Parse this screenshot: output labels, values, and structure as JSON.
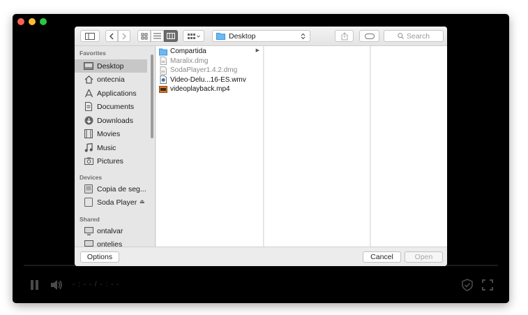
{
  "player": {
    "time_display": "- : - - / - : - -",
    "icons": [
      "close-icon",
      "minimize-icon",
      "zoom-icon",
      "pause-icon",
      "volume-icon",
      "shield-icon",
      "fullscreen-icon"
    ]
  },
  "dialog": {
    "location": "Desktop",
    "search_placeholder": "Search",
    "sidebar": {
      "favorites_header": "Favorites",
      "devices_header": "Devices",
      "shared_header": "Shared",
      "favorites": [
        {
          "label": "Desktop",
          "icon": "desktop-icon",
          "selected": true
        },
        {
          "label": "ontecnia",
          "icon": "home-icon"
        },
        {
          "label": "Applications",
          "icon": "applications-icon"
        },
        {
          "label": "Documents",
          "icon": "documents-icon"
        },
        {
          "label": "Downloads",
          "icon": "downloads-icon"
        },
        {
          "label": "Movies",
          "icon": "movies-icon"
        },
        {
          "label": "Music",
          "icon": "music-icon"
        },
        {
          "label": "Pictures",
          "icon": "pictures-icon"
        }
      ],
      "devices": [
        {
          "label": "Copia de seg...",
          "icon": "drive-icon"
        },
        {
          "label": "Soda Player",
          "icon": "disk-icon",
          "eject": "⏏"
        }
      ],
      "shared": [
        {
          "label": "ontalvar",
          "icon": "computer-icon"
        },
        {
          "label": "ontelies",
          "icon": "computer-icon"
        }
      ]
    },
    "files": [
      {
        "name": "Compartida",
        "icon": "folder-icon",
        "has_children": true
      },
      {
        "name": "Maralix.dmg",
        "icon": "dmg-icon",
        "dimmed": true
      },
      {
        "name": "SodaPlayer1.4.2.dmg",
        "icon": "dmg-icon",
        "dimmed": true
      },
      {
        "name": "Video-Delu...16-ES.wmv",
        "icon": "video-file-icon"
      },
      {
        "name": "videoplayback.mp4",
        "icon": "video-file-icon"
      }
    ],
    "footer": {
      "options_label": "Options",
      "cancel_label": "Cancel",
      "open_label": "Open"
    }
  },
  "colors": {
    "folder": "#5aaef0",
    "player_bg": "#000000",
    "dialog_bg": "#ececec"
  }
}
